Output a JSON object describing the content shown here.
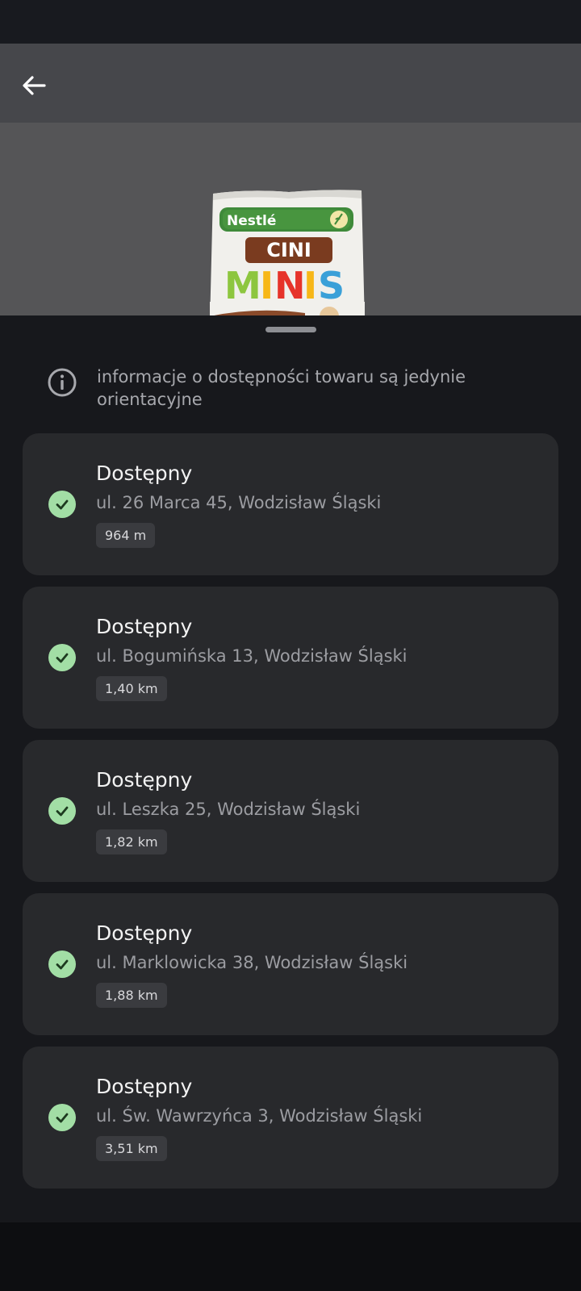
{
  "header": {
    "back_icon": "arrow-left-icon"
  },
  "product": {
    "brand": "Nestlé",
    "name_line1": "CINI",
    "name_line2": "MINIS"
  },
  "notice": {
    "icon": "info-icon",
    "text": "informacje o dostępności towaru są jedynie orientacyjne"
  },
  "stores": [
    {
      "status": "Dostępny",
      "address": "ul. 26 Marca 45, Wodzisław Śląski",
      "distance": "964 m"
    },
    {
      "status": "Dostępny",
      "address": "ul. Bogumińska 13, Wodzisław Śląski",
      "distance": "1,40 km"
    },
    {
      "status": "Dostępny",
      "address": "ul. Leszka 25, Wodzisław Śląski",
      "distance": "1,82 km"
    },
    {
      "status": "Dostępny",
      "address": "ul. Marklowicka 38, Wodzisław Śląski",
      "distance": "1,88 km"
    },
    {
      "status": "Dostępny",
      "address": "ul. Św. Wawrzyńca 3, Wodzisław Śląski",
      "distance": "3,51 km"
    }
  ],
  "colors": {
    "available": "#a2dea5",
    "card": "#28292c",
    "sheet": "#17181c",
    "top_bar": "#46474b"
  }
}
